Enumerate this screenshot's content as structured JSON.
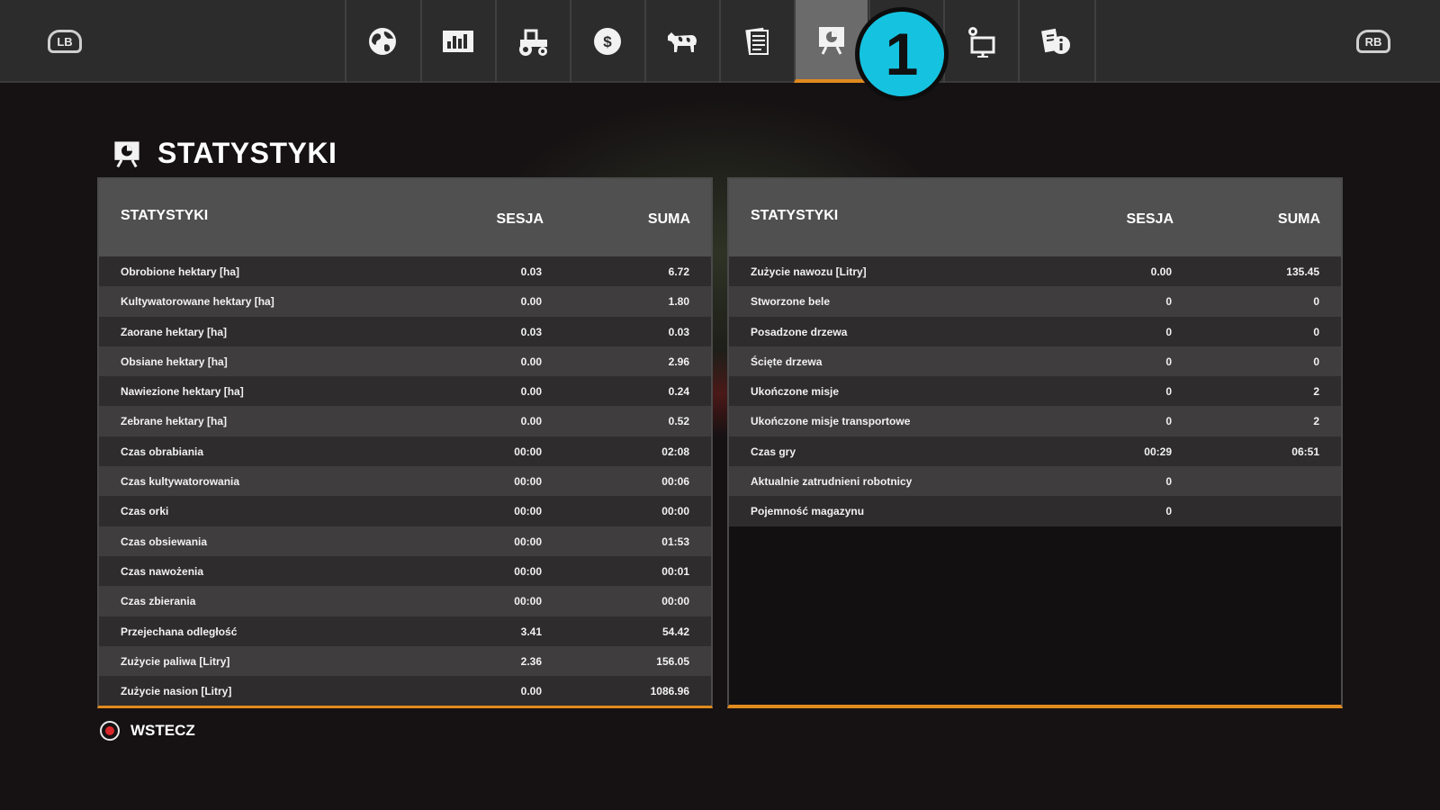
{
  "topbar": {
    "left_shoulder": "LB",
    "right_shoulder": "RB",
    "tabs": [
      {
        "name": "map",
        "icon": "globe-icon"
      },
      {
        "name": "prices",
        "icon": "bar-chart-icon"
      },
      {
        "name": "vehicles",
        "icon": "tractor-icon"
      },
      {
        "name": "finances",
        "icon": "dollar-icon"
      },
      {
        "name": "animals",
        "icon": "cow-icon"
      },
      {
        "name": "contracts",
        "icon": "contracts-icon"
      },
      {
        "name": "statistics",
        "icon": "statistics-board-icon",
        "active": true
      },
      {
        "name": "general-settings",
        "icon": "gear-icon"
      },
      {
        "name": "game-settings",
        "icon": "monitor-settings-icon"
      },
      {
        "name": "help",
        "icon": "info-icon"
      }
    ],
    "accent_color": "#e08a1e"
  },
  "callout": "1",
  "page": {
    "title": "STATYSTYKI"
  },
  "left_table": {
    "headers": {
      "stat": "STATYSTYKI",
      "session": "SESJA",
      "total": "SUMA"
    },
    "rows": [
      {
        "label": "Obrobione hektary [ha]",
        "session": "0.03",
        "total": "6.72"
      },
      {
        "label": "Kultywatorowane hektary [ha]",
        "session": "0.00",
        "total": "1.80"
      },
      {
        "label": "Zaorane hektary [ha]",
        "session": "0.03",
        "total": "0.03"
      },
      {
        "label": "Obsiane hektary [ha]",
        "session": "0.00",
        "total": "2.96"
      },
      {
        "label": "Nawiezione hektary [ha]",
        "session": "0.00",
        "total": "0.24"
      },
      {
        "label": "Zebrane hektary [ha]",
        "session": "0.00",
        "total": "0.52"
      },
      {
        "label": "Czas obrabiania",
        "session": "00:00",
        "total": "02:08"
      },
      {
        "label": "Czas kultywatorowania",
        "session": "00:00",
        "total": "00:06"
      },
      {
        "label": "Czas orki",
        "session": "00:00",
        "total": "00:00"
      },
      {
        "label": "Czas obsiewania",
        "session": "00:00",
        "total": "01:53"
      },
      {
        "label": "Czas nawożenia",
        "session": "00:00",
        "total": "00:01"
      },
      {
        "label": "Czas zbierania",
        "session": "00:00",
        "total": "00:00"
      },
      {
        "label": "Przejechana odległość",
        "session": "3.41",
        "total": "54.42"
      },
      {
        "label": "Zużycie paliwa [Litry]",
        "session": "2.36",
        "total": "156.05"
      },
      {
        "label": "Zużycie nasion [Litry]",
        "session": "0.00",
        "total": "1086.96"
      }
    ]
  },
  "right_table": {
    "headers": {
      "stat": "STATYSTYKI",
      "session": "SESJA",
      "total": "SUMA"
    },
    "rows": [
      {
        "label": "Zużycie nawozu [Litry]",
        "session": "0.00",
        "total": "135.45"
      },
      {
        "label": "Stworzone bele",
        "session": "0",
        "total": "0"
      },
      {
        "label": "Posadzone drzewa",
        "session": "0",
        "total": "0"
      },
      {
        "label": "Ścięte drzewa",
        "session": "0",
        "total": "0"
      },
      {
        "label": "Ukończone misje",
        "session": "0",
        "total": "2"
      },
      {
        "label": "Ukończone misje transportowe",
        "session": "0",
        "total": "2"
      },
      {
        "label": "Czas gry",
        "session": "00:29",
        "total": "06:51"
      },
      {
        "label": "Aktualnie zatrudnieni robotnicy",
        "session": "0",
        "total": ""
      },
      {
        "label": "Pojemność magazynu",
        "session": "0",
        "total": ""
      }
    ]
  },
  "footer": {
    "back_label": "WSTECZ",
    "back_button_icon": "b-button-icon",
    "back_button_color": "#d8262a"
  }
}
